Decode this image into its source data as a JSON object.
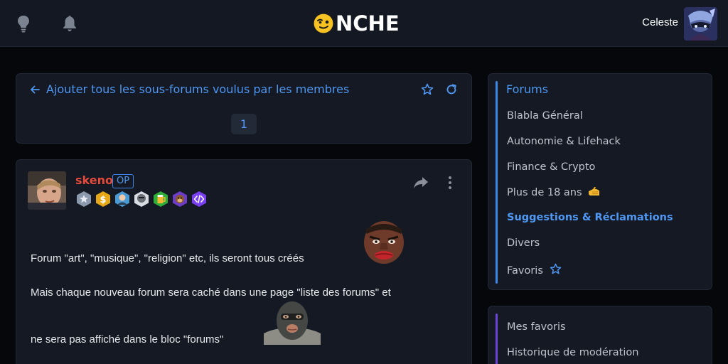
{
  "header": {
    "logo_text": "NCHE",
    "username": "Celeste",
    "icons": [
      "lightbulb-icon",
      "bell-icon",
      "onche-smiley-logo"
    ]
  },
  "topic": {
    "title": "Ajouter tous les sous-forums voulus par les membres",
    "current_page": "1"
  },
  "post": {
    "author": "skeno",
    "op_label": "OP",
    "badges": [
      "star-badge",
      "coin-badge",
      "avatar-badge",
      "face-badge",
      "beer-badge",
      "monkey-badge",
      "code-badge"
    ],
    "lines": [
      "Forum \"art\", \"musique\", \"religion\" etc, ils seront tous créés",
      "Mais chaque nouveau forum sera caché dans une page \"liste des forums\" et",
      "ne sera pas affiché dans le bloc \"forums\""
    ]
  },
  "sidebar": {
    "forums_title": "Forums",
    "forums": [
      {
        "label": "Blabla Général",
        "active": false
      },
      {
        "label": "Autonomie & Lifehack",
        "active": false
      },
      {
        "label": "Finance & Crypto",
        "active": false
      },
      {
        "label": "Plus de 18 ans",
        "active": false
      },
      {
        "label": "Suggestions & Réclamations",
        "active": true
      },
      {
        "label": "Divers",
        "active": false
      },
      {
        "label": "Favoris",
        "active": false
      }
    ],
    "links": [
      {
        "label": "Mes favoris"
      },
      {
        "label": "Historique de modération"
      }
    ]
  },
  "colors": {
    "accent": "#4f97f2",
    "author": "#e5493a",
    "background": "#05070a",
    "card": "#141923"
  }
}
